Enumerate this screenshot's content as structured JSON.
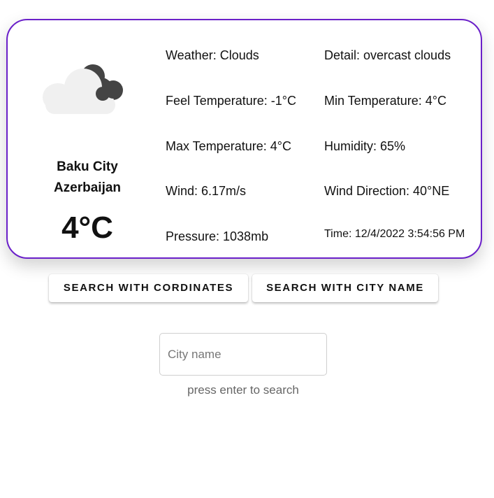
{
  "weather_card": {
    "icon": "cloud-icon",
    "city": "Baku City",
    "country": "Azerbaijan",
    "temperature": "4°C",
    "details": {
      "weather": "Weather: Clouds",
      "detail": "Detail: overcast clouds",
      "feel_temperature": "Feel Temperature: -1°C",
      "min_temperature": "Min Temperature: 4°C",
      "max_temperature": "Max Temperature: 4°C",
      "humidity": "Humidity: 65%",
      "wind": "Wind: 6.17m/s",
      "wind_direction": "Wind Direction: 40°NE",
      "pressure": "Pressure: 1038mb",
      "time": "Time: 12/4/2022 3:54:56 PM"
    },
    "border_color": "#6a1fc9"
  },
  "buttons": {
    "search_coordinates": "SEARCH WITH CORDINATES",
    "search_city": "SEARCH WITH CITY NAME"
  },
  "search": {
    "placeholder": "City name",
    "value": "",
    "helper_text": "press enter to search"
  }
}
